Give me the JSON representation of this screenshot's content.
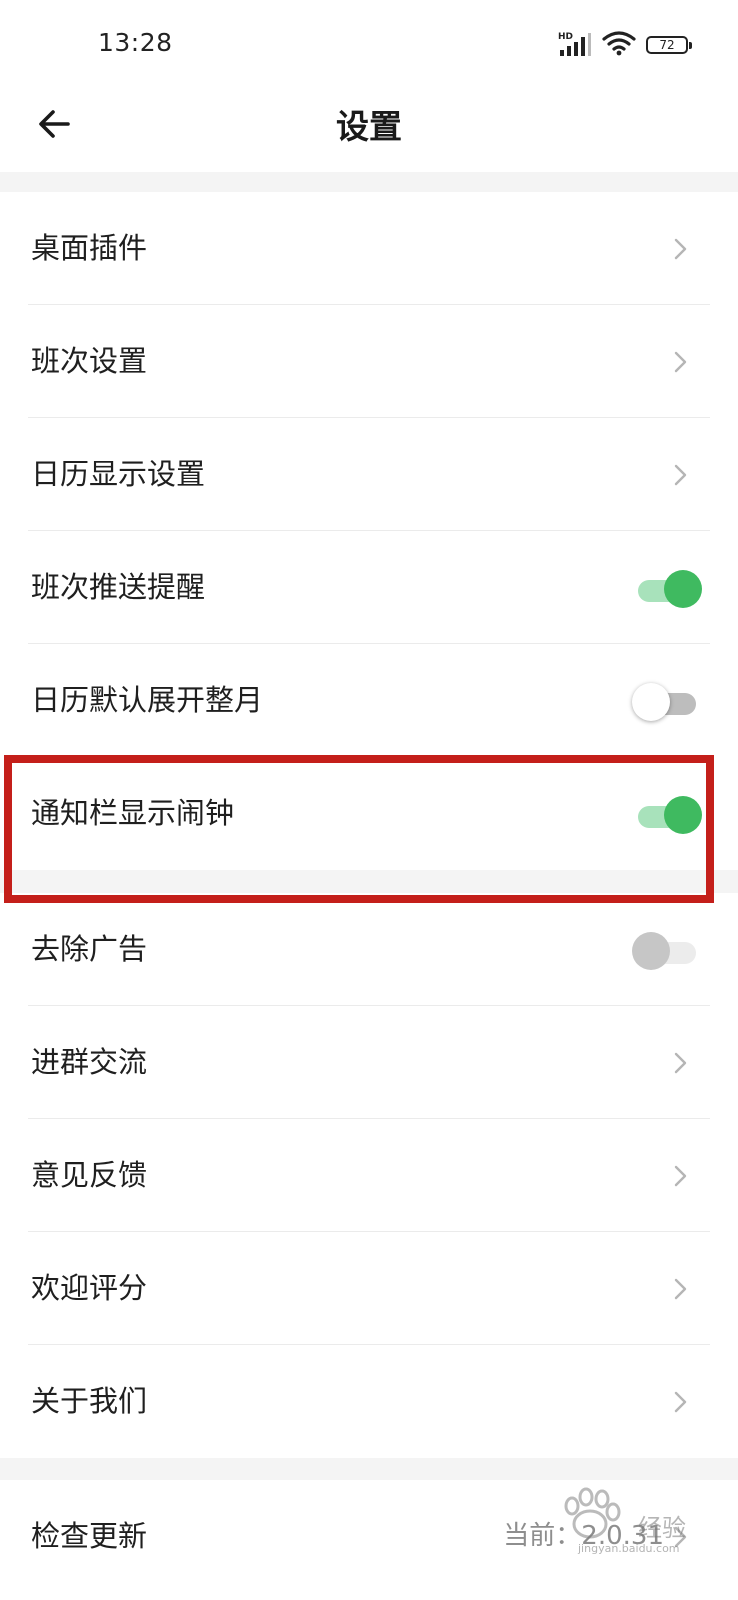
{
  "status_bar": {
    "time": "13:28",
    "network_label": "HD",
    "battery_level": "72",
    "signal_icon": "cell-signal-icon",
    "wifi_icon": "wifi-icon",
    "battery_icon": "battery-icon"
  },
  "header": {
    "title": "设置",
    "back_icon": "back-arrow-icon"
  },
  "settings": {
    "items": [
      {
        "label": "桌面插件",
        "control": "chevron"
      },
      {
        "label": "班次设置",
        "control": "chevron"
      },
      {
        "label": "日历显示设置",
        "control": "chevron"
      },
      {
        "label": "班次推送提醒",
        "control": "toggle",
        "state": "on"
      },
      {
        "label": "日历默认展开整月",
        "control": "toggle",
        "state": "off"
      },
      {
        "label": "通知栏显示闹钟",
        "control": "toggle",
        "state": "on",
        "highlighted": true
      },
      {
        "label": "去除广告",
        "control": "toggle",
        "state": "disabled"
      },
      {
        "label": "进群交流",
        "control": "chevron"
      },
      {
        "label": "意见反馈",
        "control": "chevron"
      },
      {
        "label": "欢迎评分",
        "control": "chevron"
      },
      {
        "label": "关于我们",
        "control": "chevron"
      },
      {
        "label": "检查更新",
        "control": "chevron",
        "value": "当前：2.0.31"
      }
    ]
  },
  "watermark": {
    "text": "经验",
    "sub": "jingyan.baidu.com"
  },
  "colors": {
    "toggle_on": "#3fba60",
    "toggle_on_track": "#a8e2bb",
    "toggle_off_track": "#bdbdbd",
    "highlight_border": "#c41f1a",
    "section_gap": "#f4f4f4"
  }
}
